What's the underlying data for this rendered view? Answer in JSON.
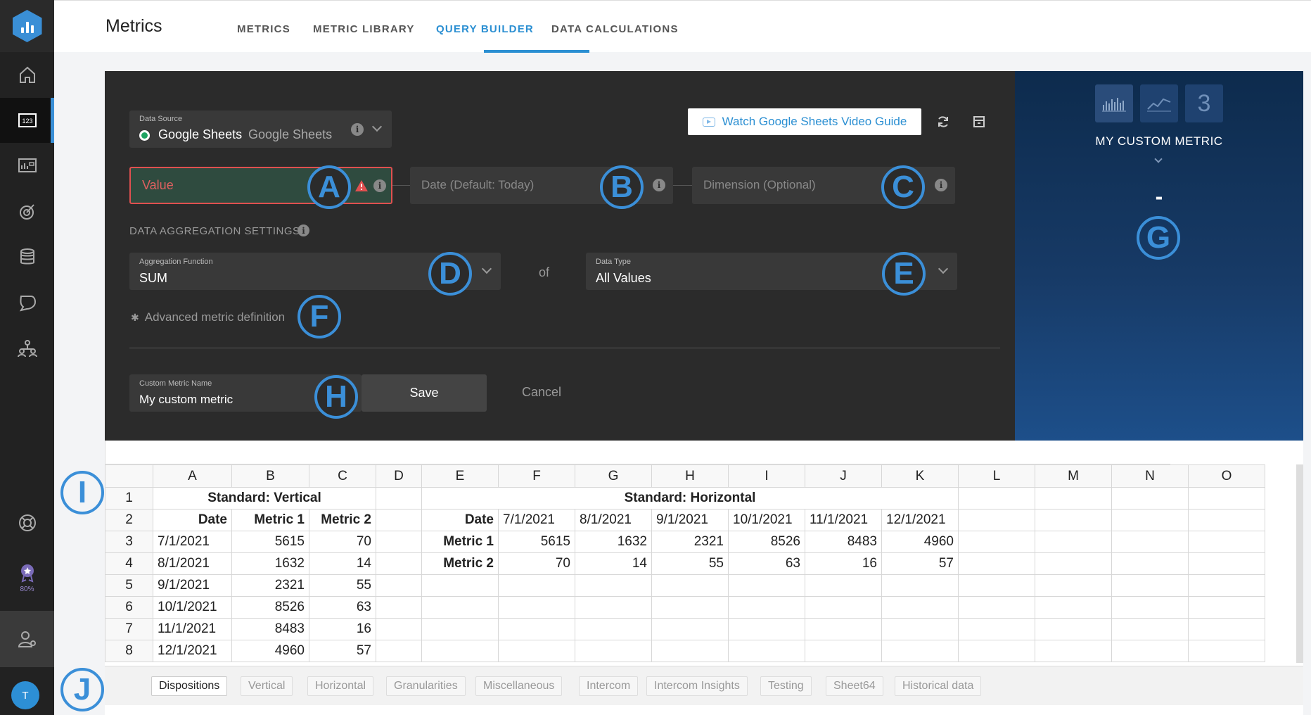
{
  "sidebar": {
    "items": [
      {
        "icon": "home-icon"
      },
      {
        "icon": "metrics-123-icon",
        "label": "123"
      },
      {
        "icon": "dashboard-icon"
      },
      {
        "icon": "goals-icon"
      },
      {
        "icon": "data-sources-icon"
      },
      {
        "icon": "comments-icon"
      },
      {
        "icon": "team-icon"
      },
      {
        "icon": "help-icon"
      },
      {
        "icon": "achievement-icon",
        "progress": "80%"
      },
      {
        "icon": "users-settings-icon"
      }
    ],
    "avatar_initial": "T"
  },
  "header": {
    "title": "Metrics",
    "tabs": [
      {
        "label": "METRICS"
      },
      {
        "label": "METRIC LIBRARY"
      },
      {
        "label": "QUERY BUILDER",
        "active": true
      },
      {
        "label": "DATA CALCULATIONS"
      }
    ]
  },
  "builder": {
    "data_source": {
      "label": "Data Source",
      "value": "Google Sheets",
      "secondary": "Google Sheets"
    },
    "watch_button": "Watch Google Sheets Video Guide",
    "value_placeholder": "Value",
    "date_placeholder": "Date (Default: Today)",
    "dimension_placeholder": "Dimension (Optional)",
    "aggregation_heading": "DATA AGGREGATION SETTINGS",
    "aggregation": {
      "label": "Aggregation Function",
      "value": "SUM"
    },
    "of_label": "of",
    "data_type": {
      "label": "Data Type",
      "value": "All Values"
    },
    "advanced_link": "Advanced metric definition",
    "custom_name": {
      "label": "Custom Metric Name",
      "value": "My custom metric"
    },
    "save_label": "Save",
    "cancel_label": "Cancel",
    "accent": "#3b8fd8",
    "error": "#e05050"
  },
  "callouts": [
    "A",
    "B",
    "C",
    "D",
    "E",
    "F",
    "G",
    "H",
    "I",
    "J"
  ],
  "preview": {
    "title": "MY CUSTOM METRIC",
    "value": "-",
    "number_glyph": "3"
  },
  "sheet": {
    "columns": [
      "A",
      "B",
      "C",
      "D",
      "E",
      "F",
      "G",
      "H",
      "I",
      "J",
      "K",
      "L",
      "M",
      "N",
      "O"
    ],
    "rows": [
      [
        "1",
        "Standard: Vertical",
        "Standard: Horizontal"
      ],
      [
        "2",
        "Date",
        "Metric 1",
        "Metric 2",
        "",
        "Date",
        "7/1/2021",
        "8/1/2021",
        "9/1/2021",
        "10/1/2021",
        "11/1/2021",
        "12/1/2021"
      ],
      [
        "3",
        "7/1/2021",
        "5615",
        "70",
        "",
        "Metric 1",
        "5615",
        "1632",
        "2321",
        "8526",
        "8483",
        "4960"
      ],
      [
        "4",
        "8/1/2021",
        "1632",
        "14",
        "",
        "Metric 2",
        "70",
        "14",
        "55",
        "63",
        "16",
        "57"
      ],
      [
        "5",
        "9/1/2021",
        "2321",
        "55"
      ],
      [
        "6",
        "10/1/2021",
        "8526",
        "63"
      ],
      [
        "7",
        "11/1/2021",
        "8483",
        "16"
      ],
      [
        "8",
        "12/1/2021",
        "4960",
        "57"
      ]
    ],
    "tabs": [
      "Dispositions",
      "Vertical",
      "Horizontal",
      "Granularities",
      "Miscellaneous",
      "Intercom",
      "Intercom Insights",
      "Testing",
      "Sheet64",
      "Historical data"
    ]
  }
}
